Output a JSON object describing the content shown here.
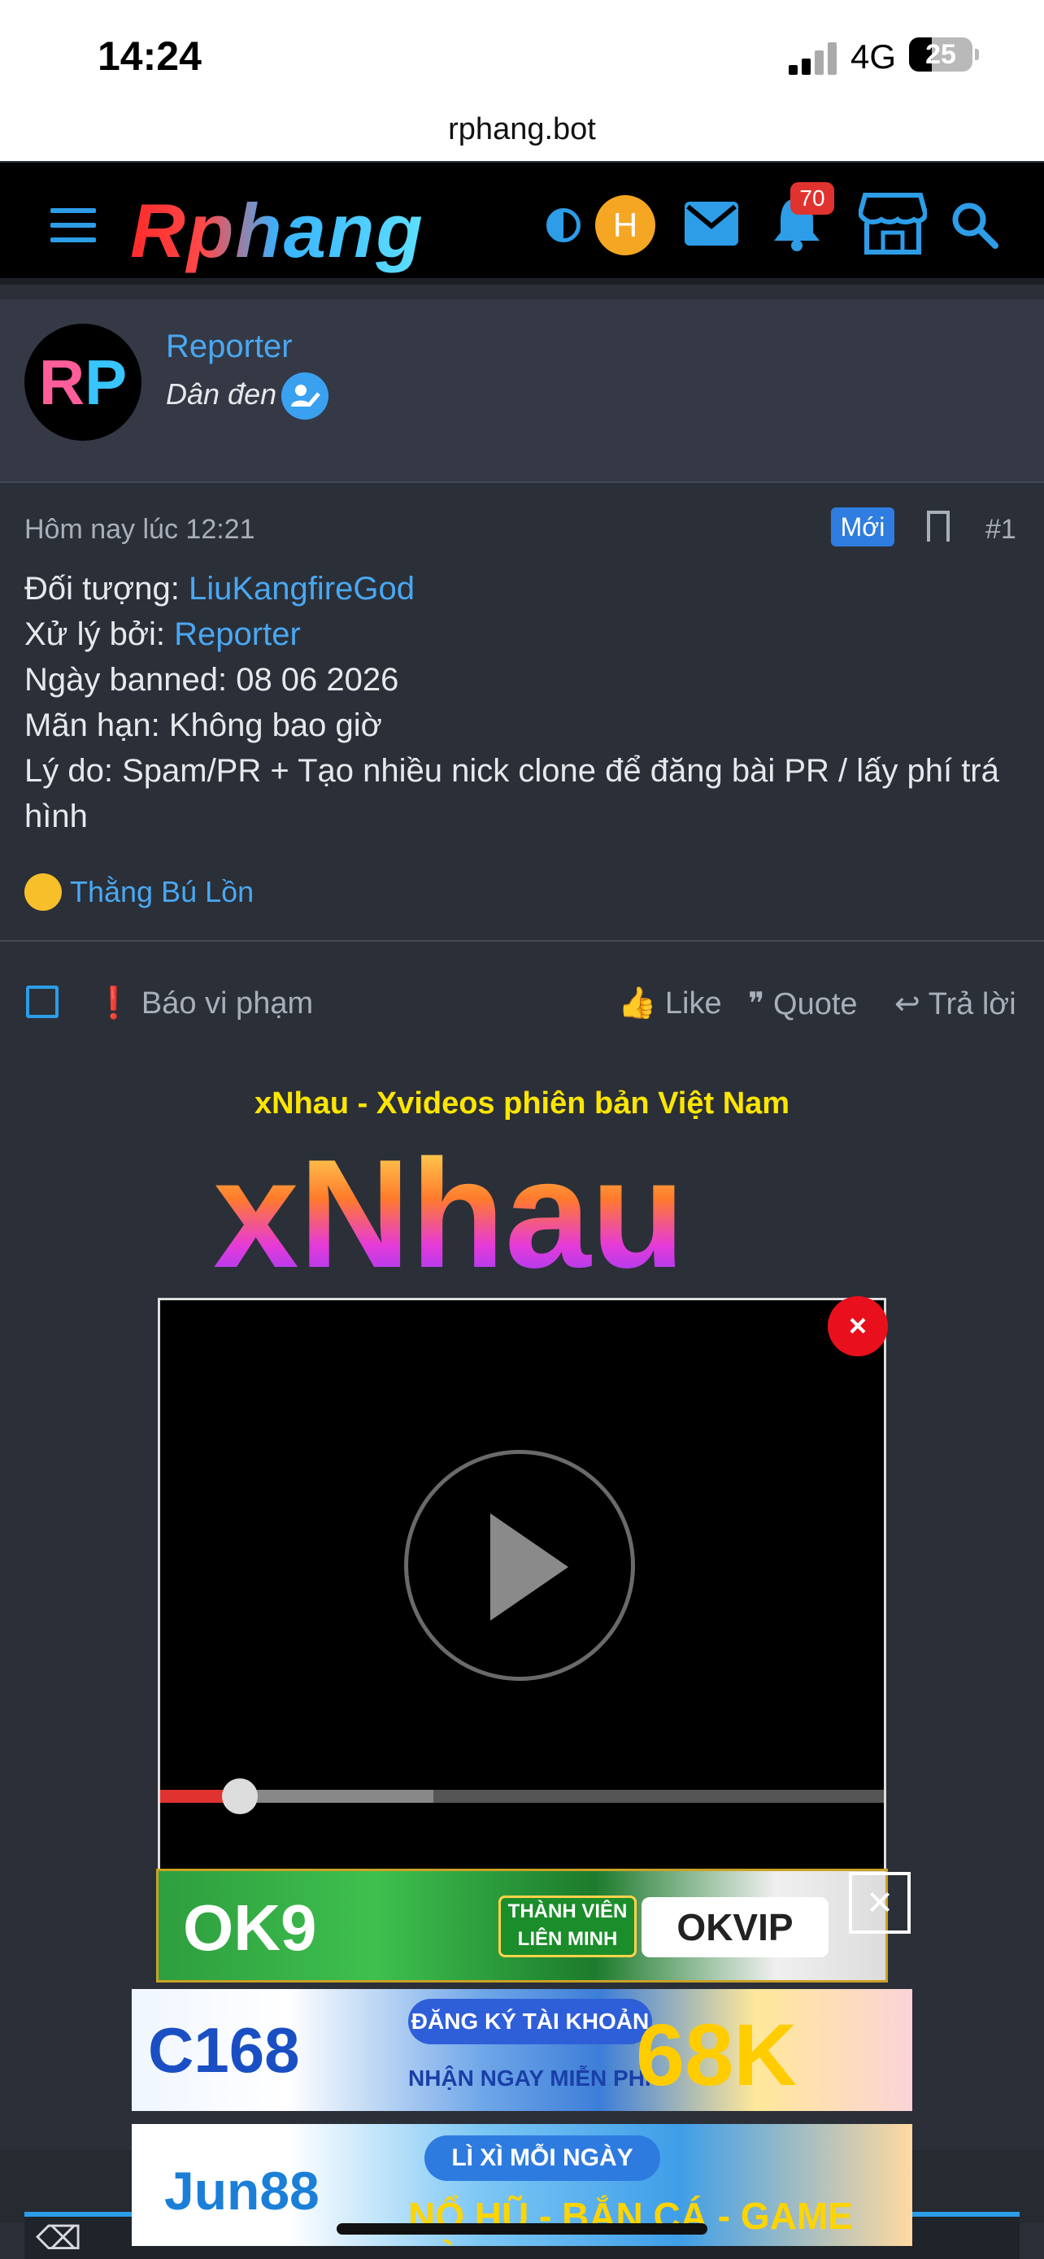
{
  "status_bar": {
    "time": "14:24",
    "network": "4G",
    "battery": "25"
  },
  "browser": {
    "url": "rphang.bot"
  },
  "header": {
    "logo": "Rphang",
    "avatar_letter": "H",
    "notification_count": "70",
    "icons": [
      "menu-icon",
      "contrast-icon",
      "mail-icon",
      "bell-icon",
      "store-icon",
      "search-icon"
    ],
    "accent_color": "#2d9de8"
  },
  "author": {
    "avatar_text_left": "R",
    "avatar_text_right": "P",
    "name": "Reporter",
    "title": "Dân đen"
  },
  "post": {
    "date": "Hôm nay lúc 12:21",
    "new_badge": "Mới",
    "number": "#1",
    "lines": [
      {
        "label": "Đối tượng: ",
        "value": "LiuKangfireGod"
      },
      {
        "label": "Xử lý bởi: ",
        "value": "Reporter"
      },
      {
        "label": "Ngày banned: 08 06 2026"
      },
      {
        "label": "Mãn hạn: Không bao giờ"
      },
      {
        "label": "Lý do: Spam/PR + Tạo nhiều nick clone để đăng bài PR / lấy phí trá hình"
      }
    ],
    "reaction_user": "Thằng Bú Lồn"
  },
  "actions": {
    "report": "Báo vi phạm",
    "like": "Like",
    "quote": "Quote",
    "reply": "Trả lời"
  },
  "ads": {
    "title": "xNhau - Xvideos phiên bản Việt Nam",
    "brand_big": "xNhau",
    "close_symbol": "×",
    "ok9": {
      "brand": "OK9",
      "member_text": "THÀNH VIÊN LIÊN MINH",
      "partner": "OKVIP"
    },
    "c168": {
      "brand": "C168",
      "cta": "ĐĂNG KÝ TÀI KHOẢN",
      "sub": "NHẬN NGAY MIỄN PHÍ",
      "amount": "68K"
    },
    "jun88": {
      "brand": "Jun88",
      "cta": "LÌ XÌ MỖI NGÀY",
      "sub": "NỔ HŨ - BẮN CÁ - GAME BÀI"
    }
  }
}
